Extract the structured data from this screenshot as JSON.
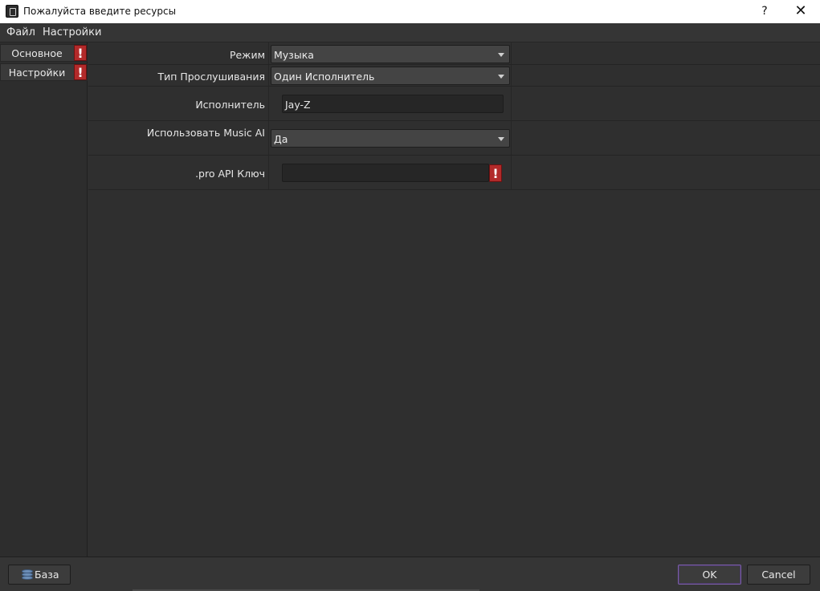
{
  "window": {
    "title": "Пожалуйста введите ресурсы",
    "help_label": "?",
    "close_label": "✕"
  },
  "menu": {
    "items": [
      {
        "label": "Файл"
      },
      {
        "label": "Настройки"
      }
    ]
  },
  "sidebar": {
    "tabs": [
      {
        "label": "Основное",
        "warning": "!"
      },
      {
        "label": "Настройки",
        "warning": "!"
      }
    ]
  },
  "form": {
    "mode": {
      "label": "Режим",
      "value": "Музыка"
    },
    "listen_type": {
      "label": "Тип Прослушивания",
      "value": "Один Исполнитель"
    },
    "artist": {
      "label": "Исполнитель",
      "value": "Jay-Z"
    },
    "use_music_ai": {
      "label": "Использовать Music AI",
      "value": "Да"
    },
    "api_key": {
      "label": ".pro API Ключ",
      "value": "",
      "warning": "!"
    }
  },
  "footer": {
    "database_label": "База",
    "ok_label": "OK",
    "cancel_label": "Cancel"
  },
  "colors": {
    "warning": "#b22a2a",
    "accent": "#7b5ea8",
    "background": "#2f2f2f"
  }
}
